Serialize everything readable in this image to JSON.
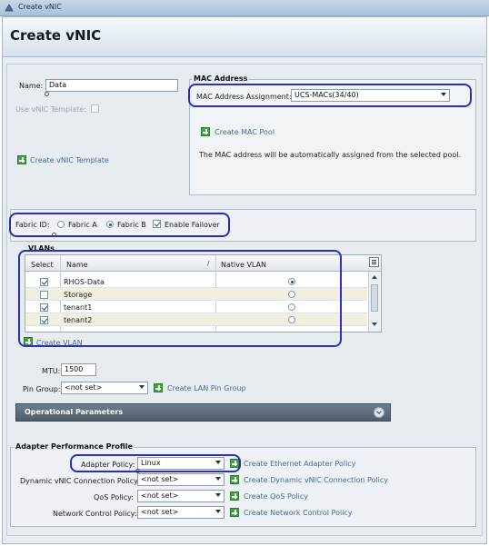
{
  "window": {
    "title": "Create vNIC"
  },
  "header": {
    "title": "Create vNIC"
  },
  "general": {
    "name_label": "Name:",
    "name_value": "Data",
    "use_template_label": "Use vNIC Template:",
    "create_template_link": "Create vNIC Template"
  },
  "mac": {
    "title": "MAC Address",
    "assignment_label": "MAC Address Assignment:",
    "assignment_value": "UCS-MACs(34/40)",
    "create_pool_link": "Create MAC Pool",
    "info_text": "The MAC address will be automatically assigned from the selected pool."
  },
  "fabric": {
    "label": "Fabric ID:",
    "option_a": "Fabric A",
    "option_b": "Fabric B",
    "selected": "Fabric B",
    "failover_label": "Enable Failover",
    "failover_checked": true
  },
  "vlans": {
    "title": "VLANs",
    "columns": [
      "Select",
      "Name",
      "Native VLAN"
    ],
    "rows": [
      {
        "select": true,
        "name": "RHOS-Data",
        "native": true
      },
      {
        "select": false,
        "name": "Storage",
        "native": false
      },
      {
        "select": true,
        "name": "tenant1",
        "native": false
      },
      {
        "select": true,
        "name": "tenant2",
        "native": false
      }
    ],
    "create_link": "Create VLAN"
  },
  "mtu": {
    "label": "MTU:",
    "value": "1500"
  },
  "pin_group": {
    "label": "Pin Group:",
    "value": "<not set>",
    "create_link": "Create LAN Pin Group"
  },
  "operational": {
    "title": "Operational Parameters"
  },
  "adapter": {
    "title": "Adapter Performance Profile",
    "rows": [
      {
        "label": "Adapter Policy:",
        "value": "Linux",
        "link": "Create Ethernet Adapter Policy"
      },
      {
        "label": "Dynamic vNIC Connection Policy:",
        "value": "<not set>",
        "link": "Create Dynamic vNIC Connection Policy"
      },
      {
        "label": "QoS Policy:",
        "value": "<not set>",
        "link": "Create QoS Policy"
      },
      {
        "label": "Network Control Policy:",
        "value": "<not set>",
        "link": "Create Network Control Policy"
      }
    ]
  },
  "colors": {
    "highlight": "#2b2fb8",
    "accent_green": "#3fa63f",
    "op_bar": "#5e6b7a"
  }
}
